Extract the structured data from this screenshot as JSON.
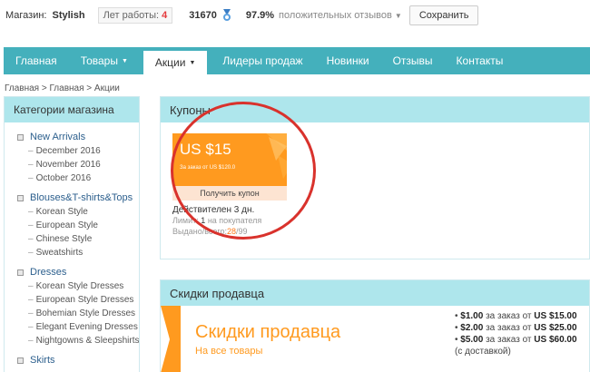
{
  "store": {
    "label": "Магазин:",
    "name": "Stylish",
    "years_label": "Лет работы:",
    "years_value": "4",
    "score": "31670",
    "feedback_pct": "97.9%",
    "feedback_label": "положительных отзывов",
    "save_label": "Сохранить"
  },
  "nav": {
    "items": [
      {
        "label": "Главная"
      },
      {
        "label": "Товары"
      },
      {
        "label": "Акции"
      },
      {
        "label": "Лидеры продаж"
      },
      {
        "label": "Новинки"
      },
      {
        "label": "Отзывы"
      },
      {
        "label": "Контакты"
      }
    ]
  },
  "breadcrumb": "Главная > Главная > Акции",
  "sidebar": {
    "title": "Категории магазина",
    "categories": [
      {
        "name": "New Arrivals",
        "items": [
          "December 2016",
          "November 2016",
          "October 2016"
        ]
      },
      {
        "name": "Blouses&T-shirts&Tops",
        "items": [
          "Korean Style",
          "European Style",
          "Chinese Style",
          "Sweatshirts"
        ]
      },
      {
        "name": "Dresses",
        "items": [
          "Korean Style Dresses",
          "European Style Dresses",
          "Bohemian Style Dresses",
          "Elegant Evening Dresses",
          "Nightgowns & Sleepshirts"
        ]
      },
      {
        "name": "Skirts",
        "items": []
      }
    ]
  },
  "coupons": {
    "title": "Купоны",
    "amount": "US $15",
    "min_order": "За заказ от US $120.0",
    "get_label": "Получить купон",
    "valid": "Действителен 3 дн.",
    "limit_pre": "Лимит:",
    "limit_value": "1",
    "limit_post": "на покупателя",
    "issued_label": "Выдано/всего:",
    "issued_value": "28",
    "total_value": "/99"
  },
  "discounts": {
    "title": "Скидки продавца",
    "banner_title": "Скидки продавца",
    "banner_sub": "На все товары",
    "tiers": [
      {
        "off": "$1.00",
        "mid": "за заказ от",
        "min": "US $15.00"
      },
      {
        "off": "$2.00",
        "mid": "за заказ от",
        "min": "US $25.00"
      },
      {
        "off": "$5.00",
        "mid": "за заказ от",
        "min": "US $60.00"
      }
    ],
    "shipping_note": "(с доставкой)"
  },
  "colors": {
    "teal": "#44b0bc",
    "light_teal": "#aee6ec",
    "orange": "#ff9a1f",
    "annotation_red": "#d9322c"
  }
}
